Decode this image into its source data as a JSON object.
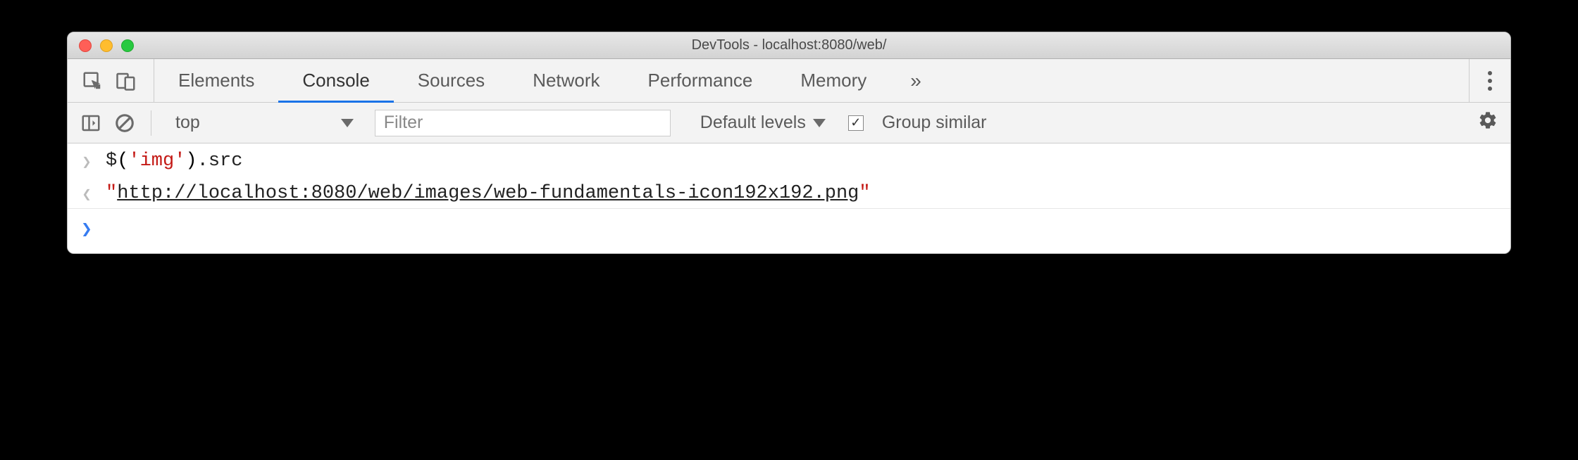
{
  "window": {
    "title": "DevTools - localhost:8080/web/"
  },
  "tabs": {
    "elements": "Elements",
    "console": "Console",
    "sources": "Sources",
    "network": "Network",
    "performance": "Performance",
    "memory": "Memory",
    "overflow": "»"
  },
  "toolbar": {
    "scope": "top",
    "filter_placeholder": "Filter",
    "levels": "Default levels",
    "group_similar": "Group similar",
    "group_similar_checked": true
  },
  "console": {
    "input_fn": "$",
    "input_paren_open": "(",
    "input_str": "'img'",
    "input_paren_close": ")",
    "input_dot_prop": ".src",
    "result_quote": "\"",
    "result_url": "http://localhost:8080/web/images/web-fundamentals-icon192x192.png"
  }
}
